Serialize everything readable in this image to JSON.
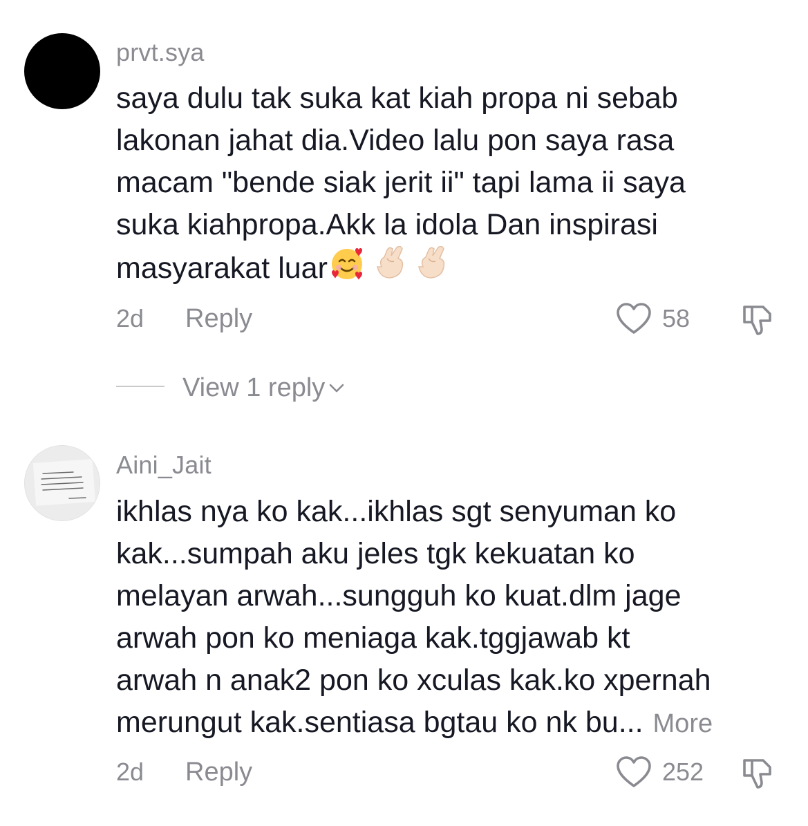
{
  "comments": [
    {
      "username": "prvt.sya",
      "avatar": "black-circle-avatar",
      "lines": [
        "saya dulu tak suka kat kiah propa ni sebab",
        "lakonan jahat dia.Video lalu pon saya rasa",
        "macam \"bende siak jerit ii\" tapi lama ii saya",
        "suka kiahpropa.Akk la idola Dan inspirasi",
        "masyarakat luar"
      ],
      "emojis": [
        "smiling-face-with-hearts-emoji",
        "hand-with-index-finger-and-thumb-crossed-emoji",
        "hand-with-index-finger-and-thumb-crossed-emoji"
      ],
      "time": "2d",
      "reply_label": "Reply",
      "likes": "58",
      "view_replies": "View 1 reply"
    },
    {
      "username": "Aini_Jait",
      "avatar": "photo-text-avatar",
      "lines": [
        "ikhlas nya ko kak...ikhlas sgt senyuman ko",
        "kak...sumpah aku jeles tgk kekuatan ko",
        "melayan arwah...sungguh ko kuat.dlm jage",
        "arwah pon ko meniaga kak.tggjawab kt",
        "arwah n anak2 pon ko xculas kak.ko xpernah",
        "merungut kak.sentiasa bgtau ko nk bu"
      ],
      "ellipsis": "...",
      "more_label": "More",
      "time": "2d",
      "reply_label": "Reply",
      "likes": "252"
    }
  ],
  "colors": {
    "text": "#161823",
    "secondary": "#8a8b91",
    "divider": "#c9c9cc"
  }
}
